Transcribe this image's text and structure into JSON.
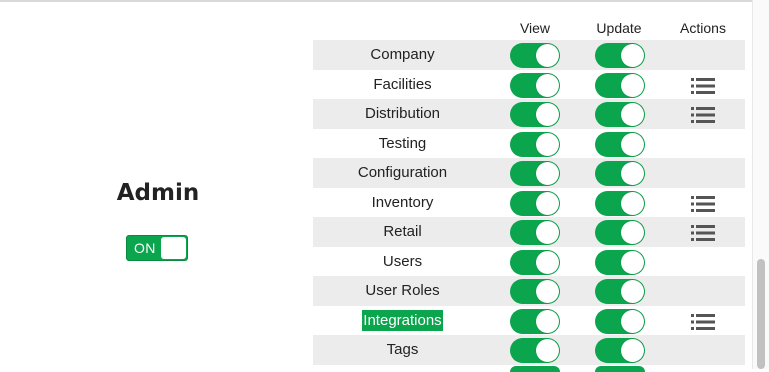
{
  "admin": {
    "title": "Admin",
    "toggle_label": "ON"
  },
  "table": {
    "headers": {
      "view": "View",
      "update": "Update",
      "actions": "Actions"
    },
    "rows": [
      {
        "label": "Company",
        "view": true,
        "update": true,
        "actions_icon": false,
        "highlighted": false
      },
      {
        "label": "Facilities",
        "view": true,
        "update": true,
        "actions_icon": true,
        "highlighted": false
      },
      {
        "label": "Distribution",
        "view": true,
        "update": true,
        "actions_icon": true,
        "highlighted": false
      },
      {
        "label": "Testing",
        "view": true,
        "update": true,
        "actions_icon": false,
        "highlighted": false
      },
      {
        "label": "Configuration",
        "view": true,
        "update": true,
        "actions_icon": false,
        "highlighted": false
      },
      {
        "label": "Inventory",
        "view": true,
        "update": true,
        "actions_icon": true,
        "highlighted": false
      },
      {
        "label": "Retail",
        "view": true,
        "update": true,
        "actions_icon": true,
        "highlighted": false
      },
      {
        "label": "Users",
        "view": true,
        "update": true,
        "actions_icon": false,
        "highlighted": false
      },
      {
        "label": "User Roles",
        "view": true,
        "update": true,
        "actions_icon": false,
        "highlighted": false
      },
      {
        "label": "Integrations",
        "view": true,
        "update": true,
        "actions_icon": true,
        "highlighted": true
      },
      {
        "label": "Tags",
        "view": true,
        "update": true,
        "actions_icon": false,
        "highlighted": false
      }
    ]
  },
  "colors": {
    "toggle_on": "#0aa54c",
    "row_alt": "#ececec",
    "icon": "#555555"
  }
}
